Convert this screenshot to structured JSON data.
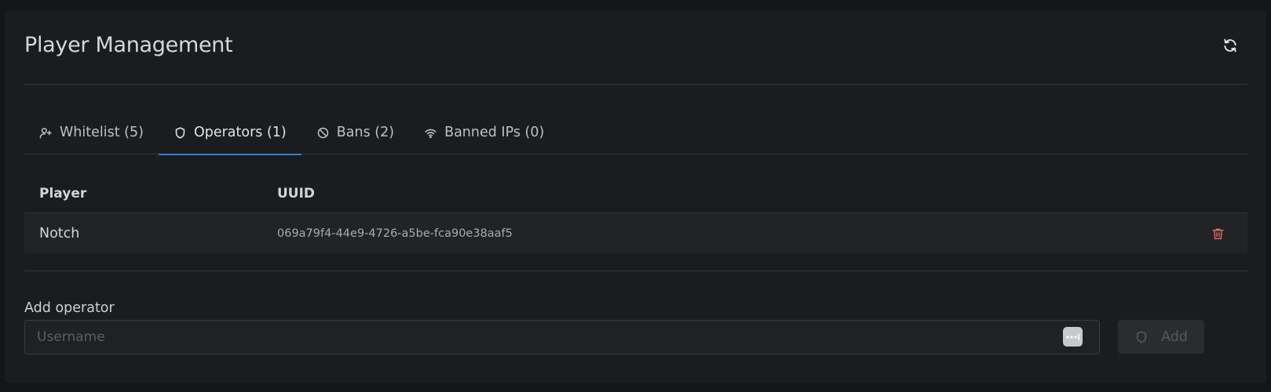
{
  "header": {
    "title": "Player Management"
  },
  "tabs": [
    {
      "label": "Whitelist (5)",
      "icon": "user-plus-icon",
      "active": false
    },
    {
      "label": "Operators (1)",
      "icon": "shield-icon",
      "active": true
    },
    {
      "label": "Bans (2)",
      "icon": "ban-icon",
      "active": false
    },
    {
      "label": "Banned IPs (0)",
      "icon": "wifi-icon",
      "active": false
    }
  ],
  "table": {
    "columns": [
      "Player",
      "UUID"
    ],
    "rows": [
      {
        "player": "Notch",
        "uuid": "069a79f4-44e9-4726-a5be-fca90e38aaf5"
      }
    ]
  },
  "add_form": {
    "label": "Add operator",
    "placeholder": "Username",
    "value": "",
    "button_label": "Add"
  },
  "colors": {
    "accent": "#2f7fd3",
    "danger": "#e06b6b",
    "background": "#1b1c1f"
  }
}
